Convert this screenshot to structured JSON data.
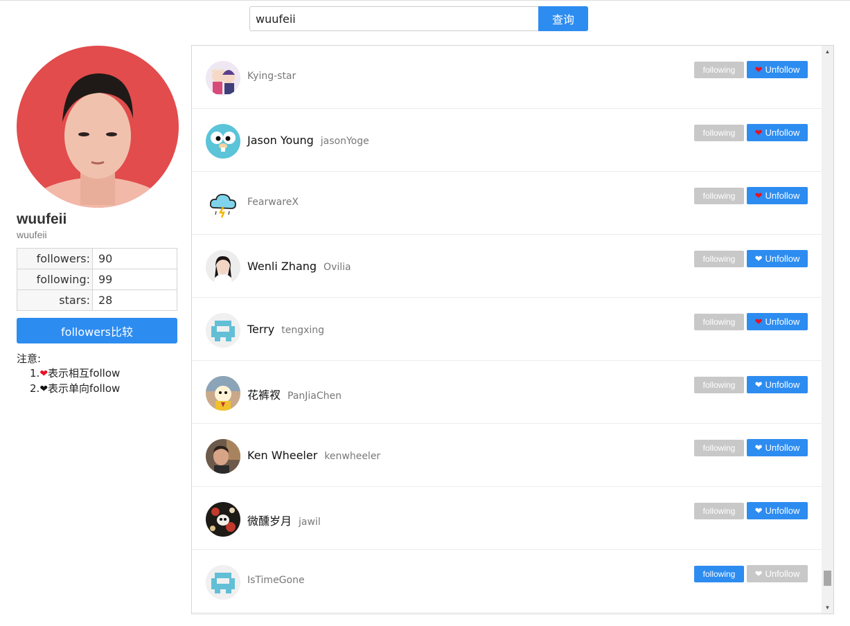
{
  "search": {
    "value": "wuufeii",
    "button_label": "查询"
  },
  "profile": {
    "name": "wuufeii",
    "login": "wuufeii",
    "stats": [
      {
        "label": "followers:",
        "value": "90"
      },
      {
        "label": "following:",
        "value": "99"
      },
      {
        "label": "stars:",
        "value": "28"
      }
    ],
    "compare_label": "followers比较",
    "note_title": "注意:",
    "note_lines": [
      {
        "prefix": "1.",
        "heart": "red",
        "text": "表示相互follow"
      },
      {
        "prefix": "2.",
        "heart": "black",
        "text": "表示单向follow"
      }
    ]
  },
  "users": [
    {
      "name": "",
      "login": "Kying-star",
      "avatar": "anime-avatar-icon",
      "following_active": false,
      "mutual": true,
      "unfollow_enabled": true
    },
    {
      "name": "Jason Young",
      "login": "jasonYoge",
      "avatar": "gopher-avatar-icon",
      "following_active": false,
      "mutual": true,
      "unfollow_enabled": true
    },
    {
      "name": "",
      "login": "FearwareX",
      "avatar": "storm-cloud-avatar-icon",
      "following_active": false,
      "mutual": true,
      "unfollow_enabled": true
    },
    {
      "name": "Wenli Zhang",
      "login": "Ovilia",
      "avatar": "portrait-avatar-icon",
      "following_active": false,
      "mutual": false,
      "unfollow_enabled": true
    },
    {
      "name": "Terry",
      "login": "tengxing",
      "avatar": "identicon-avatar-icon",
      "following_active": false,
      "mutual": true,
      "unfollow_enabled": true
    },
    {
      "name": "花裤衩",
      "login": "PanJiaChen",
      "avatar": "cartoon-avatar-icon",
      "following_active": false,
      "mutual": false,
      "unfollow_enabled": true
    },
    {
      "name": "Ken Wheeler",
      "login": "kenwheeler",
      "avatar": "photo-avatar-icon",
      "following_active": false,
      "mutual": false,
      "unfollow_enabled": true
    },
    {
      "name": "微醺岁月",
      "login": "jawil",
      "avatar": "art-avatar-icon",
      "following_active": false,
      "mutual": false,
      "unfollow_enabled": true
    },
    {
      "name": "",
      "login": "IsTimeGone",
      "avatar": "identicon-avatar-icon",
      "following_active": true,
      "mutual": false,
      "unfollow_enabled": false
    }
  ],
  "buttons": {
    "following_label": "following",
    "unfollow_label": "Unfollow"
  },
  "colors": {
    "accent": "#2d8cf0",
    "muted": "#c8c8c8",
    "heart_red": "#e81123"
  },
  "scroll": {
    "position": 0.97
  }
}
